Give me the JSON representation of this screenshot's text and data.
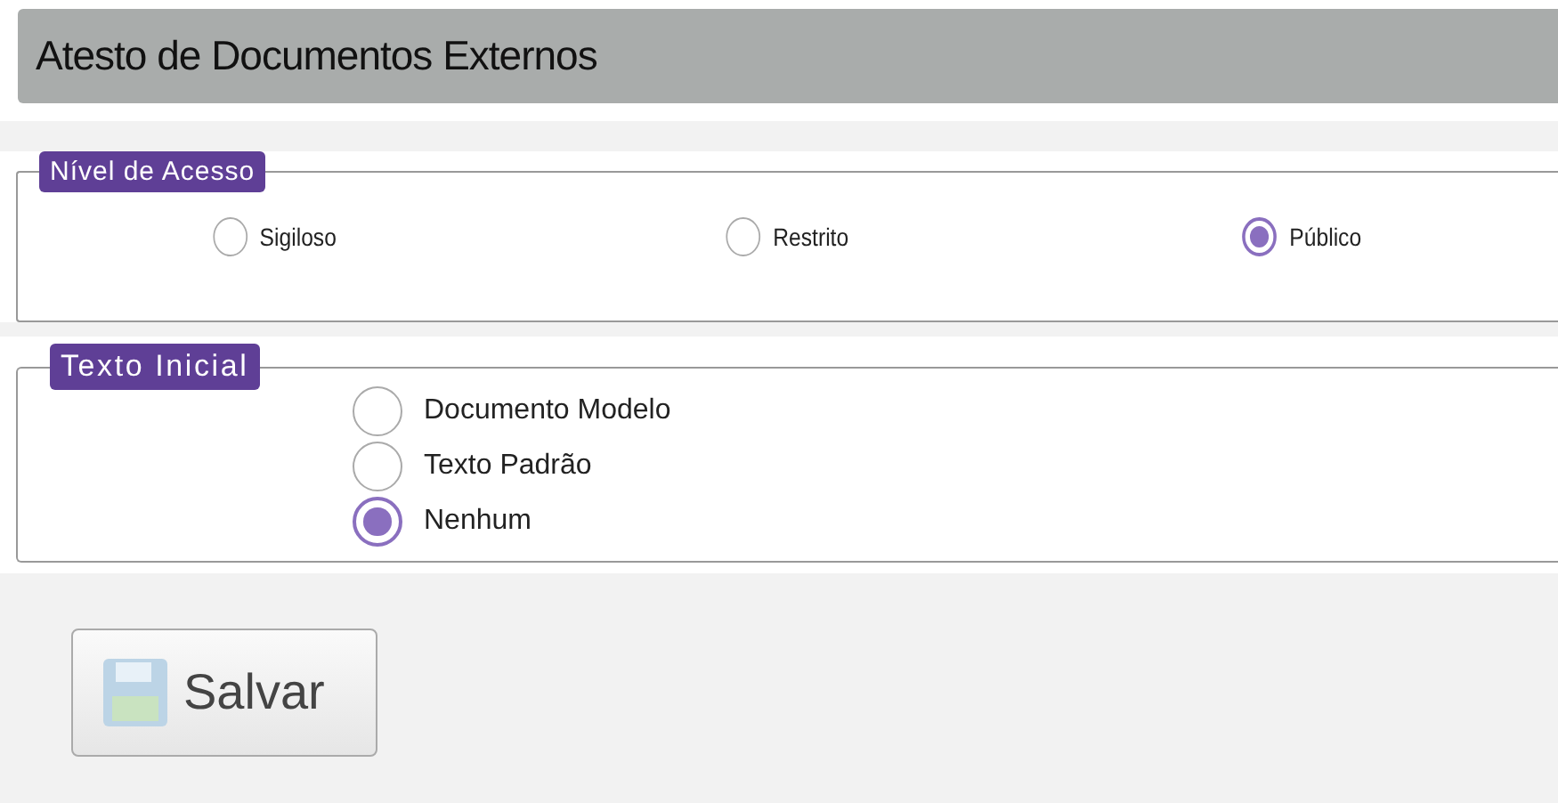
{
  "title": "Atesto de Documentos Externos",
  "access_level": {
    "legend": "Nível de Acesso",
    "options": [
      {
        "label": "Sigiloso",
        "selected": false
      },
      {
        "label": "Restrito",
        "selected": false
      },
      {
        "label": "Público",
        "selected": true
      }
    ]
  },
  "initial_text": {
    "legend": "Texto Inicial",
    "options": [
      {
        "label": "Documento Modelo",
        "selected": false
      },
      {
        "label": "Texto Padrão",
        "selected": false
      },
      {
        "label": "Nenhum",
        "selected": true
      }
    ]
  },
  "save_button": {
    "label": "Salvar"
  }
}
